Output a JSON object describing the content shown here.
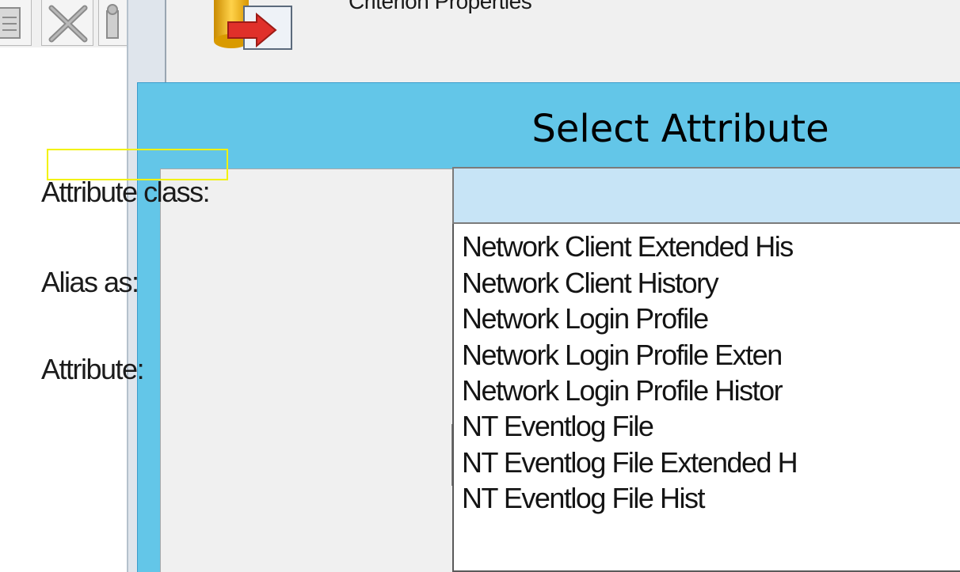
{
  "parent_window": {
    "title": "Criterion Properties"
  },
  "toolbar": {
    "buttons": [
      {
        "icon": "properties-icon"
      },
      {
        "icon": "delete-icon"
      },
      {
        "icon": "tool-icon"
      }
    ]
  },
  "dialog": {
    "title": "Select Attribute",
    "labels": {
      "attribute_class": "Attribute class:",
      "alias_as": "Alias as:",
      "attribute": "Attribute:"
    },
    "attribute_class_combo": {
      "value": ""
    },
    "dropdown_items": [
      "Network Client Extended His",
      "Network Client History",
      "Network Login Profile",
      "Network Login Profile Exten",
      "Network Login Profile Histor",
      "NT Eventlog File",
      "NT Eventlog File Extended H",
      "NT Eventlog File Hist"
    ]
  },
  "colors": {
    "dialog_frame": "#63c6e8",
    "combo_highlight": "#c7e4f6",
    "selection_outline": "#f2f200"
  }
}
